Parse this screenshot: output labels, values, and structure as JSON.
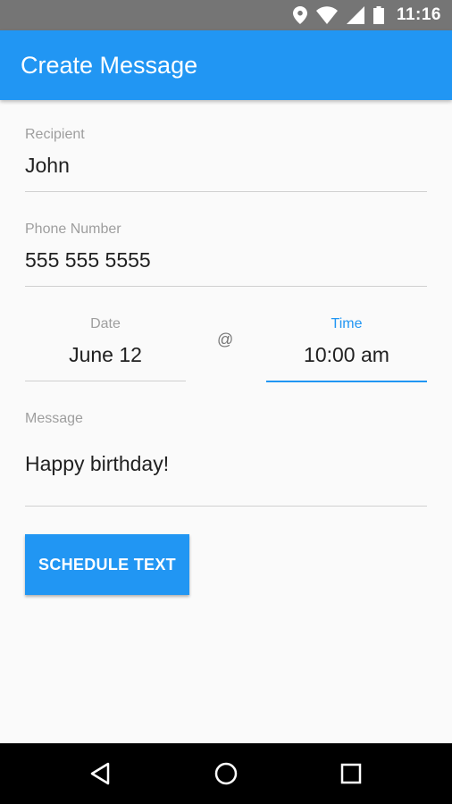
{
  "status_bar": {
    "time": "11:16",
    "icons": [
      "location-icon",
      "wifi-icon",
      "signal-icon",
      "battery-icon"
    ]
  },
  "app_bar": {
    "title": "Create Message"
  },
  "form": {
    "recipient": {
      "label": "Recipient",
      "value": "John"
    },
    "phone": {
      "label": "Phone Number",
      "value": "555 555 5555"
    },
    "date": {
      "label": "Date",
      "value": "June 12"
    },
    "at_sign": "@",
    "time": {
      "label": "Time",
      "value": "10:00 am"
    },
    "message": {
      "label": "Message",
      "value": "Happy birthday!"
    }
  },
  "actions": {
    "schedule_label": "SCHEDULE TEXT"
  },
  "colors": {
    "primary": "#2196f3",
    "status_bar": "#757575",
    "nav_bar": "#000000"
  },
  "nav_bar": {
    "buttons": [
      "back-icon",
      "home-icon",
      "recents-icon"
    ]
  }
}
